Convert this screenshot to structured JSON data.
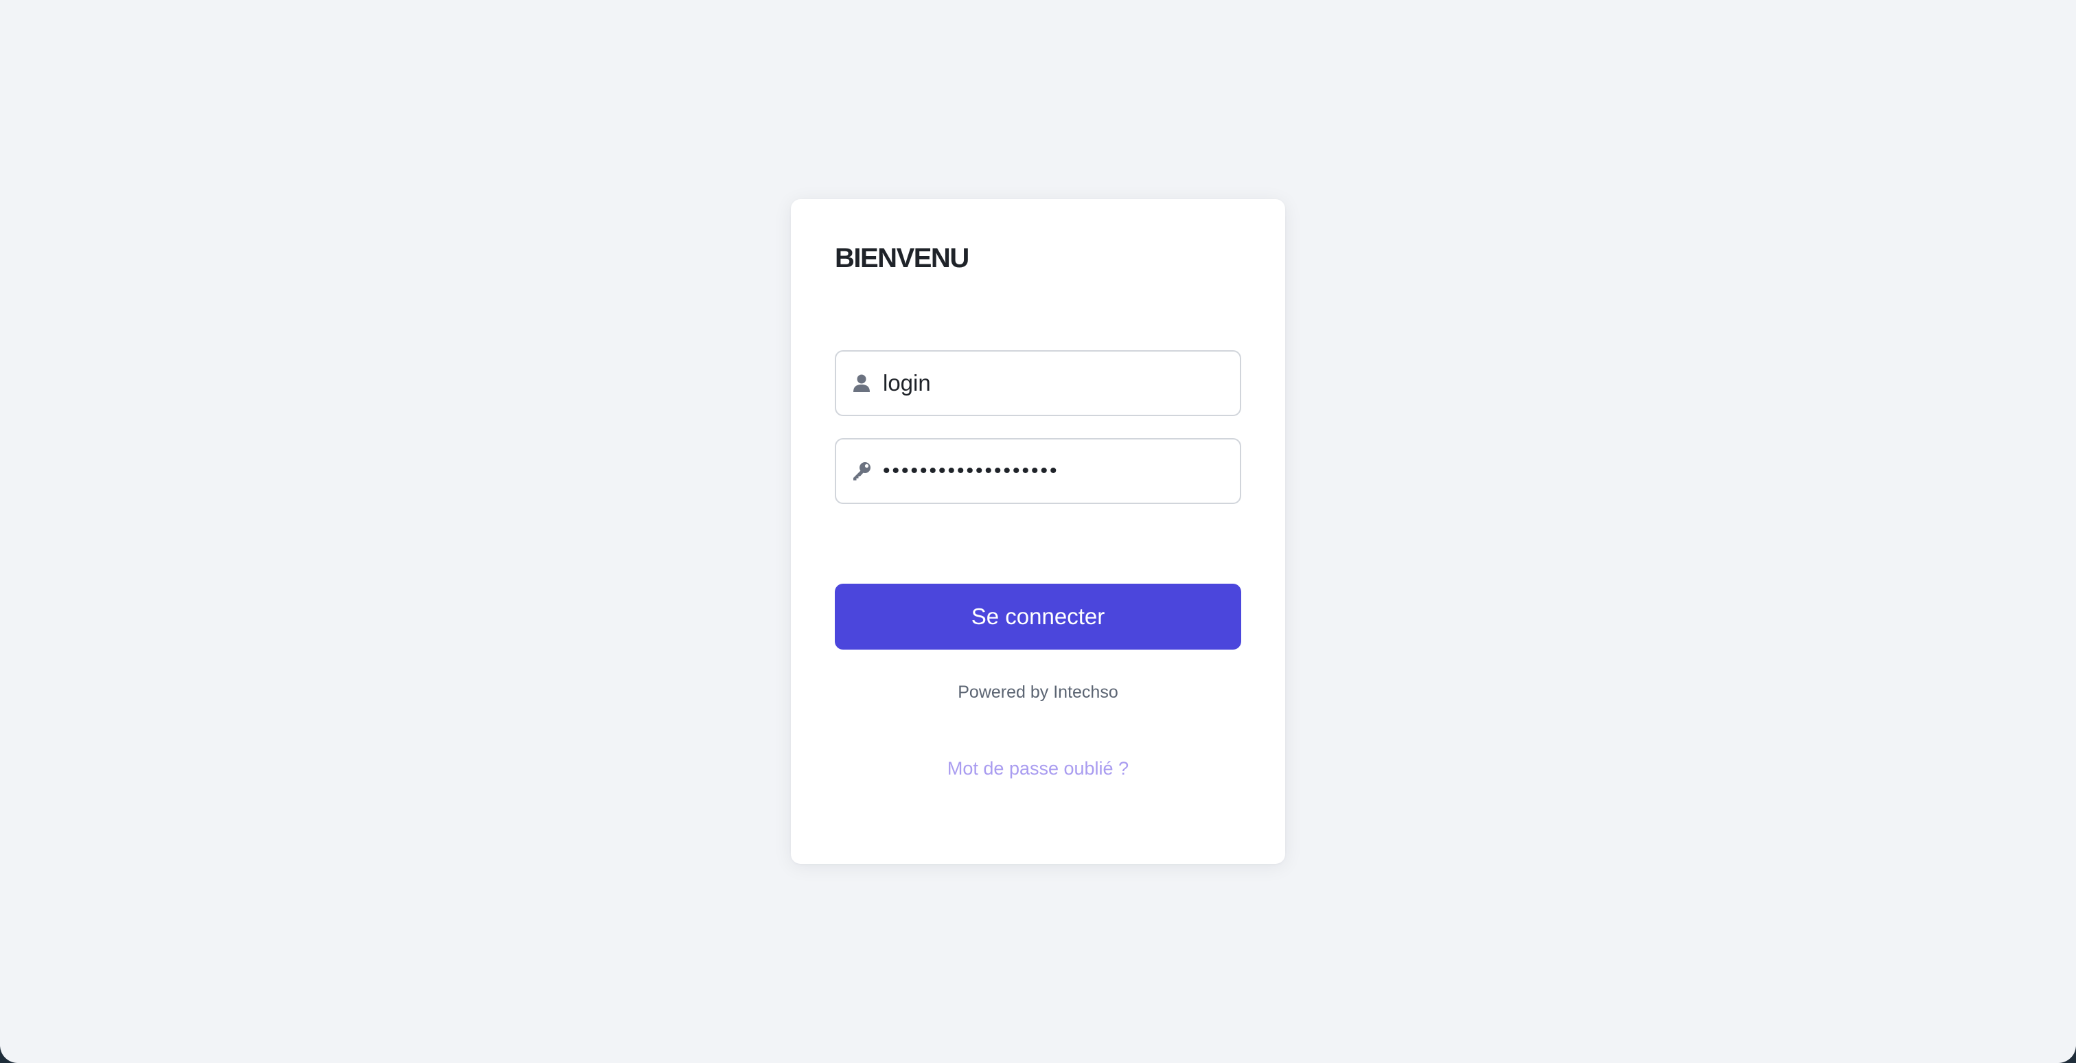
{
  "login_card": {
    "title": "BIENVENU",
    "login_field": {
      "placeholder": "login",
      "value": "",
      "icon": "user-icon"
    },
    "password_field": {
      "value": "•••••••••••••••••••",
      "icon": "key-icon"
    },
    "submit_label": "Se connecter",
    "powered_by": "Powered by Intechso",
    "forgot_password_link": "Mot de passe oublié ?"
  },
  "colors": {
    "background": "#f2f4f7",
    "card": "#ffffff",
    "accent": "#4b46dc",
    "link": "#a99cf0",
    "icon": "#6b7280"
  }
}
